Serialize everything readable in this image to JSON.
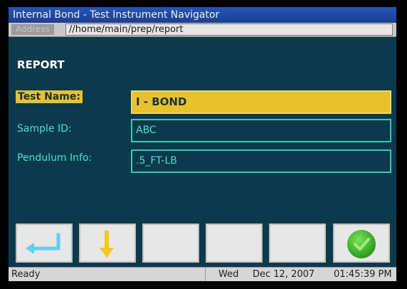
{
  "window": {
    "title": "Internal Bond - Test Instrument Navigator"
  },
  "address_bar": {
    "label": "Address",
    "path": "//home/main/prep/report"
  },
  "page": {
    "heading": "REPORT"
  },
  "form": {
    "fields": [
      {
        "label": "Test Name:",
        "value": "I - BOND",
        "selected": true
      },
      {
        "label": "Sample ID:",
        "value": "ABC",
        "selected": false
      },
      {
        "label": "Pendulum Info:",
        "value": ".5_FT-LB",
        "selected": false
      }
    ]
  },
  "toolbar": {
    "buttons": [
      {
        "name": "enter-button",
        "icon": "enter-arrow-icon"
      },
      {
        "name": "down-button",
        "icon": "down-arrow-icon"
      },
      {
        "name": "blank-button-1",
        "icon": ""
      },
      {
        "name": "blank-button-2",
        "icon": ""
      },
      {
        "name": "blank-button-3",
        "icon": ""
      },
      {
        "name": "ok-button",
        "icon": "check-circle-icon"
      }
    ]
  },
  "status_bar": {
    "status": "Ready",
    "day": "Wed",
    "date": "Dec 12, 2007",
    "time": "01:45:39 PM"
  },
  "colors": {
    "background": "#0c3a4c",
    "title_bar": "#1b3f8f",
    "highlight": "#e8c22a",
    "field_text": "#3fe0d0",
    "enter_arrow": "#5fd0f0",
    "down_arrow": "#f2c81e",
    "ok_green": "#3cb82a"
  }
}
